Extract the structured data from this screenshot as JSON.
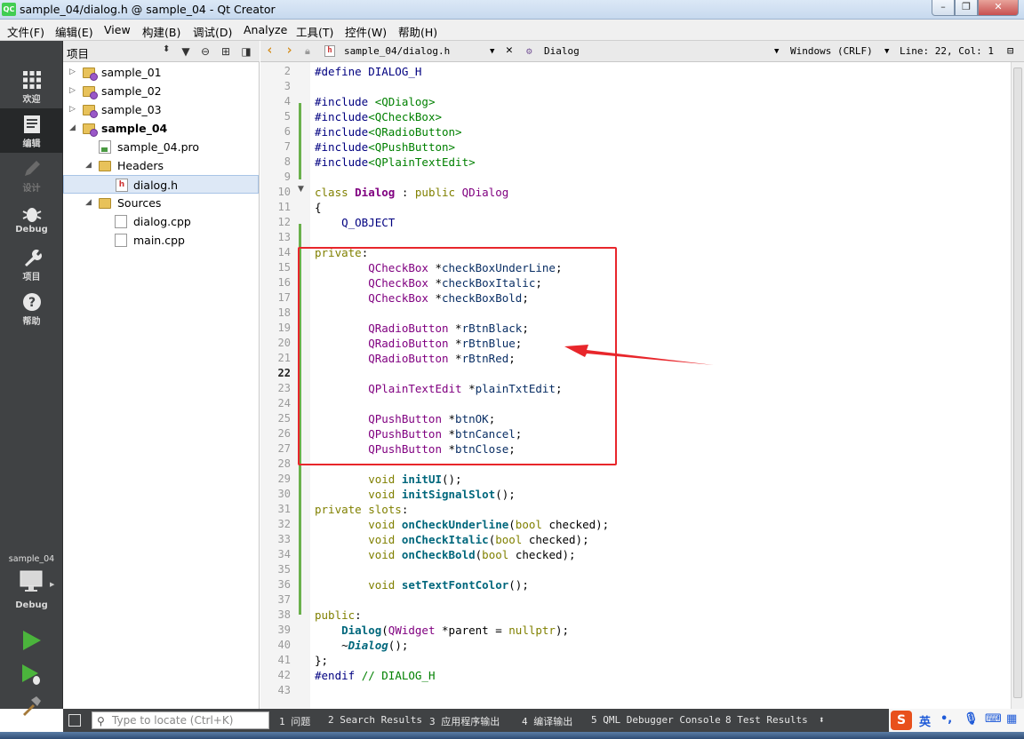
{
  "window": {
    "title": "sample_04/dialog.h @ sample_04 - Qt Creator",
    "app_icon_text": "QC",
    "min_icon": "minimize-icon",
    "max_icon": "maximize-icon",
    "close_icon": "close-icon"
  },
  "menu": [
    "文件(F)",
    "编辑(E)",
    "View",
    "构建(B)",
    "调试(D)",
    "Analyze",
    "工具(T)",
    "控件(W)",
    "帮助(H)"
  ],
  "modes": [
    {
      "label": "欢迎",
      "icon": "grid-icon",
      "state": "normal"
    },
    {
      "label": "编辑",
      "icon": "edit-icon",
      "state": "active"
    },
    {
      "label": "设计",
      "icon": "pencil-icon",
      "state": "disabled"
    },
    {
      "label": "Debug",
      "icon": "bug-icon",
      "state": "normal"
    },
    {
      "label": "项目",
      "icon": "wrench-icon",
      "state": "normal"
    },
    {
      "label": "帮助",
      "icon": "help-icon",
      "state": "normal"
    }
  ],
  "kit": {
    "project": "sample_04",
    "build": "Debug"
  },
  "project_panel": {
    "title": "项目",
    "tree": [
      {
        "label": "sample_01",
        "type": "project",
        "bold": false
      },
      {
        "label": "sample_02",
        "type": "project",
        "bold": false
      },
      {
        "label": "sample_03",
        "type": "project",
        "bold": false
      },
      {
        "label": "sample_04",
        "type": "project",
        "bold": true
      },
      {
        "label": "sample_04.pro",
        "type": "pro"
      },
      {
        "label": "Headers",
        "type": "folder"
      },
      {
        "label": "dialog.h",
        "type": "header",
        "selected": true
      },
      {
        "label": "Sources",
        "type": "folder"
      },
      {
        "label": "dialog.cpp",
        "type": "file"
      },
      {
        "label": "main.cpp",
        "type": "file"
      }
    ]
  },
  "editor_toolbar": {
    "file": "sample_04/dialog.h",
    "symbol": "Dialog",
    "line_ending": "Windows (CRLF)",
    "position": "Line: 22, Col: 1"
  },
  "editor": {
    "current_line": 22,
    "lines": [
      {
        "n": 2,
        "t": [
          [
            "c-pre",
            "#define DIALOG_H"
          ]
        ]
      },
      {
        "n": 3,
        "t": []
      },
      {
        "n": 4,
        "t": [
          [
            "c-pre",
            "#include "
          ],
          [
            "c-inc",
            "<QDialog>"
          ]
        ]
      },
      {
        "n": 5,
        "t": [
          [
            "c-pre",
            "#include"
          ],
          [
            "c-inc",
            "<QCheckBox>"
          ]
        ]
      },
      {
        "n": 6,
        "t": [
          [
            "c-pre",
            "#include"
          ],
          [
            "c-inc",
            "<QRadioButton>"
          ]
        ]
      },
      {
        "n": 7,
        "t": [
          [
            "c-pre",
            "#include"
          ],
          [
            "c-inc",
            "<QPushButton>"
          ]
        ]
      },
      {
        "n": 8,
        "t": [
          [
            "c-pre",
            "#include"
          ],
          [
            "c-inc",
            "<QPlainTextEdit>"
          ]
        ]
      },
      {
        "n": 9,
        "t": []
      },
      {
        "n": 10,
        "t": [
          [
            "c-kw",
            "class "
          ],
          [
            "c-cls",
            "Dialog"
          ],
          [
            "c-plain",
            " : "
          ],
          [
            "c-kw",
            "public "
          ],
          [
            "c-type",
            "QDialog"
          ]
        ]
      },
      {
        "n": 11,
        "t": [
          [
            "c-plain",
            "{"
          ]
        ]
      },
      {
        "n": 12,
        "t": [
          [
            "c-mac",
            "    Q_OBJECT"
          ]
        ]
      },
      {
        "n": 13,
        "t": []
      },
      {
        "n": 14,
        "t": [
          [
            "c-kw",
            "private"
          ],
          [
            "c-plain",
            ":"
          ]
        ]
      },
      {
        "n": 15,
        "t": [
          [
            "c-type",
            "        QCheckBox "
          ],
          [
            "c-plain",
            "*"
          ],
          [
            "c-var",
            "checkBoxUnderLine"
          ],
          [
            "c-plain",
            ";"
          ]
        ]
      },
      {
        "n": 16,
        "t": [
          [
            "c-type",
            "        QCheckBox "
          ],
          [
            "c-plain",
            "*"
          ],
          [
            "c-var",
            "checkBoxItalic"
          ],
          [
            "c-plain",
            ";"
          ]
        ]
      },
      {
        "n": 17,
        "t": [
          [
            "c-type",
            "        QCheckBox "
          ],
          [
            "c-plain",
            "*"
          ],
          [
            "c-var",
            "checkBoxBold"
          ],
          [
            "c-plain",
            ";"
          ]
        ]
      },
      {
        "n": 18,
        "t": []
      },
      {
        "n": 19,
        "t": [
          [
            "c-type",
            "        QRadioButton "
          ],
          [
            "c-plain",
            "*"
          ],
          [
            "c-var",
            "rBtnBlack"
          ],
          [
            "c-plain",
            ";"
          ]
        ]
      },
      {
        "n": 20,
        "t": [
          [
            "c-type",
            "        QRadioButton "
          ],
          [
            "c-plain",
            "*"
          ],
          [
            "c-var",
            "rBtnBlue"
          ],
          [
            "c-plain",
            ";"
          ]
        ]
      },
      {
        "n": 21,
        "t": [
          [
            "c-type",
            "        QRadioButton "
          ],
          [
            "c-plain",
            "*"
          ],
          [
            "c-var",
            "rBtnRed"
          ],
          [
            "c-plain",
            ";"
          ]
        ]
      },
      {
        "n": 22,
        "t": []
      },
      {
        "n": 23,
        "t": [
          [
            "c-type",
            "        QPlainTextEdit "
          ],
          [
            "c-plain",
            "*"
          ],
          [
            "c-var",
            "plainTxtEdit"
          ],
          [
            "c-plain",
            ";"
          ]
        ]
      },
      {
        "n": 24,
        "t": []
      },
      {
        "n": 25,
        "t": [
          [
            "c-type",
            "        QPushButton "
          ],
          [
            "c-plain",
            "*"
          ],
          [
            "c-var",
            "btnOK"
          ],
          [
            "c-plain",
            ";"
          ]
        ]
      },
      {
        "n": 26,
        "t": [
          [
            "c-type",
            "        QPushButton "
          ],
          [
            "c-plain",
            "*"
          ],
          [
            "c-var",
            "btnCancel"
          ],
          [
            "c-plain",
            ";"
          ]
        ]
      },
      {
        "n": 27,
        "t": [
          [
            "c-type",
            "        QPushButton "
          ],
          [
            "c-plain",
            "*"
          ],
          [
            "c-var",
            "btnClose"
          ],
          [
            "c-plain",
            ";"
          ]
        ]
      },
      {
        "n": 28,
        "t": []
      },
      {
        "n": 29,
        "t": [
          [
            "c-kw",
            "        void "
          ],
          [
            "c-func",
            "initUI"
          ],
          [
            "c-plain",
            "();"
          ]
        ]
      },
      {
        "n": 30,
        "t": [
          [
            "c-kw",
            "        void "
          ],
          [
            "c-func",
            "initSignalSlot"
          ],
          [
            "c-plain",
            "();"
          ]
        ]
      },
      {
        "n": 31,
        "t": [
          [
            "c-kw",
            "private slots"
          ],
          [
            "c-plain",
            ":"
          ]
        ]
      },
      {
        "n": 32,
        "t": [
          [
            "c-kw",
            "        void "
          ],
          [
            "c-func",
            "onCheckUnderline"
          ],
          [
            "c-plain",
            "("
          ],
          [
            "c-kw",
            "bool "
          ],
          [
            "c-plain",
            "checked);"
          ]
        ]
      },
      {
        "n": 33,
        "t": [
          [
            "c-kw",
            "        void "
          ],
          [
            "c-func",
            "onCheckItalic"
          ],
          [
            "c-plain",
            "("
          ],
          [
            "c-kw",
            "bool "
          ],
          [
            "c-plain",
            "checked);"
          ]
        ]
      },
      {
        "n": 34,
        "t": [
          [
            "c-kw",
            "        void "
          ],
          [
            "c-func",
            "onCheckBold"
          ],
          [
            "c-plain",
            "("
          ],
          [
            "c-kw",
            "bool "
          ],
          [
            "c-plain",
            "checked);"
          ]
        ]
      },
      {
        "n": 35,
        "t": []
      },
      {
        "n": 36,
        "t": [
          [
            "c-kw",
            "        void "
          ],
          [
            "c-func",
            "setTextFontColor"
          ],
          [
            "c-plain",
            "();"
          ]
        ]
      },
      {
        "n": 37,
        "t": []
      },
      {
        "n": 38,
        "t": [
          [
            "c-kw",
            "public"
          ],
          [
            "c-plain",
            ":"
          ]
        ]
      },
      {
        "n": 39,
        "t": [
          [
            "c-func",
            "    Dialog"
          ],
          [
            "c-plain",
            "("
          ],
          [
            "c-type",
            "QWidget "
          ],
          [
            "c-plain",
            "*parent = "
          ],
          [
            "c-kw",
            "nullptr"
          ],
          [
            "c-plain",
            ");"
          ]
        ]
      },
      {
        "n": 40,
        "t": [
          [
            "c-plain",
            "    ~"
          ],
          [
            "c-func c-it",
            "Dialog"
          ],
          [
            "c-plain",
            "();"
          ]
        ]
      },
      {
        "n": 41,
        "t": [
          [
            "c-plain",
            "};"
          ]
        ]
      },
      {
        "n": 42,
        "t": [
          [
            "c-pre",
            "#endif "
          ],
          [
            "c-com",
            "// DIALOG_H"
          ]
        ]
      },
      {
        "n": 43,
        "t": []
      }
    ]
  },
  "output_bar": {
    "locator_placeholder": "Type to locate (Ctrl+K)",
    "tabs": [
      "1  问题",
      "2  Search Results",
      "3  应用程序输出",
      "4  编译输出",
      "5  QML Debugger Console",
      "8  Test Results"
    ]
  },
  "ime": {
    "logo": "S",
    "lang": "英"
  },
  "colors": {
    "annotation": "#e8262b",
    "modebar": "#404244"
  }
}
